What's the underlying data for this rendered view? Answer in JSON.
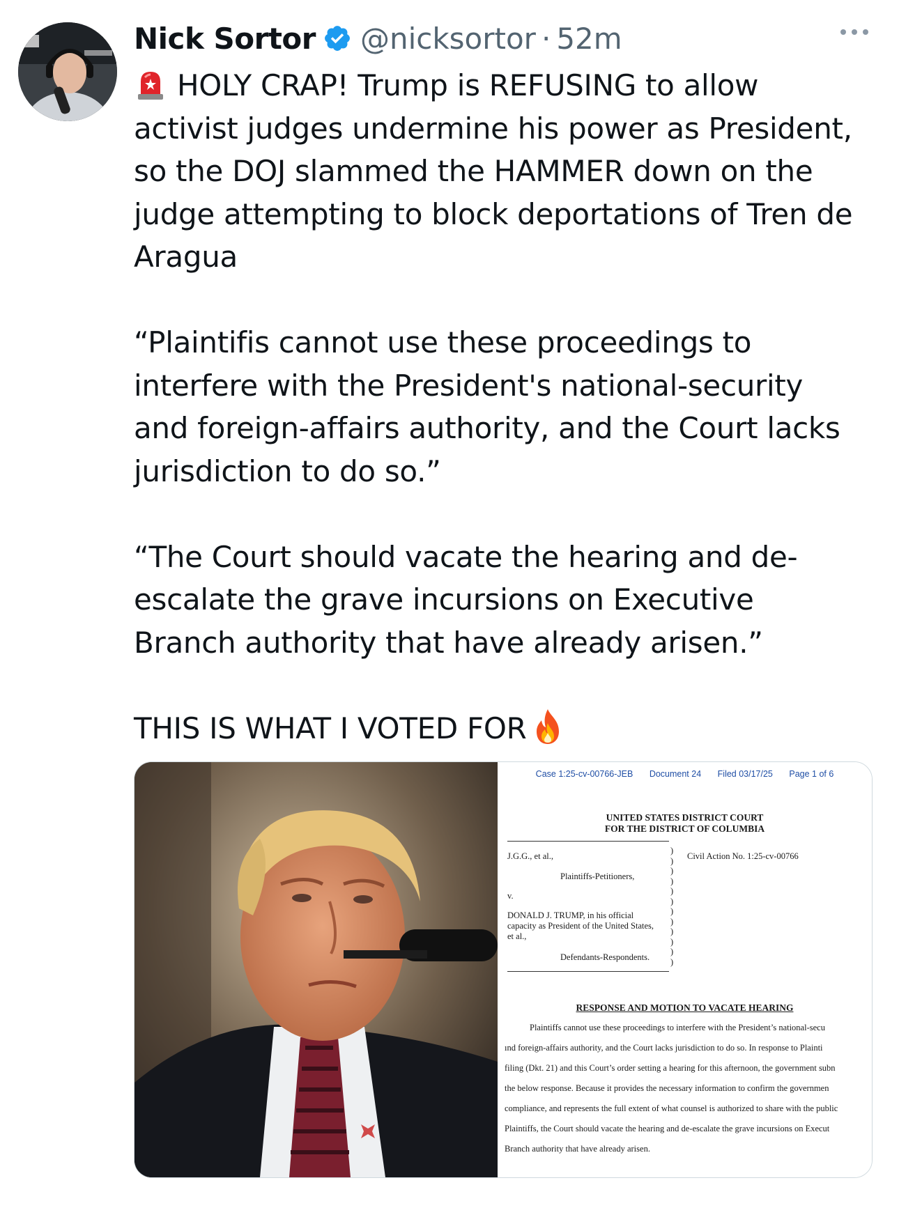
{
  "tweet": {
    "author": {
      "name": "Nick Sortor",
      "handle": "@nicksortor",
      "verified": true,
      "avatar_icon": "profile-photo"
    },
    "separator": "·",
    "timestamp": "52m",
    "more_icon": "more-dots-icon",
    "paragraphs": [
      {
        "emoji_before": "siren-emoji",
        "lines": [
          "HOLY CRAP! Trump is REFUSING to allow",
          "activist judges undermine his power as President,",
          "so the DOJ slammed the HAMMER down on the",
          "judge attempting to block deportations of Tren de",
          "Aragua"
        ]
      },
      {
        "lines": [
          "“Plaintifis cannot use these proceedings to",
          "interfere with the President's national-security",
          "and foreign-affairs authority, and the Court lacks",
          "jurisdiction to do so.”"
        ]
      },
      {
        "lines": [
          "“The Court should vacate the hearing and de-",
          "escalate the grave incursions on Executive",
          "Branch authority that have already arisen.”"
        ]
      },
      {
        "lines": [
          "THIS IS WHAT I VOTED FOR"
        ],
        "emoji_after": "fire-emoji"
      }
    ]
  },
  "media": {
    "photo_icon": "president-photo",
    "document": {
      "header": {
        "case": "Case 1:25-cv-00766-JEB",
        "document": "Document 24",
        "filed": "Filed 03/17/25",
        "page": "Page 1 of 6"
      },
      "court_line1": "UNITED STATES DISTRICT COURT",
      "court_line2": "FOR THE DISTRICT OF COLUMBIA",
      "plaintiff": "J.G.G., et al.,",
      "plaintiff_role": "Plaintiffs-Petitioners,",
      "versus": "v.",
      "defendant1": "DONALD J. TRUMP, in his official",
      "defendant2": "capacity as President of the United States,",
      "defendant3": "et al.,",
      "defendant_role": "Defendants-Respondents.",
      "civil_action": "Civil Action No. 1:25-cv-00766",
      "title": "RESPONSE AND MOTION TO VACATE HEARING",
      "body_lines": [
        "Plaintiffs cannot use these proceedings to interfere with the President’s national-secu",
        "ınd foreign-affairs authority, and the Court lacks jurisdiction to do so.  In response to Plainti",
        "filing (Dkt. 21) and this Court’s order setting a hearing for this afternoon, the government subn",
        "the below response.  Because it provides the necessary information to confirm the governmen",
        "compliance, and represents the full extent of what counsel is authorized to share with the public",
        "Plaintiffs, the Court should vacate the hearing and de-escalate the grave incursions on Execut",
        "Branch authority that have already arisen."
      ]
    }
  }
}
